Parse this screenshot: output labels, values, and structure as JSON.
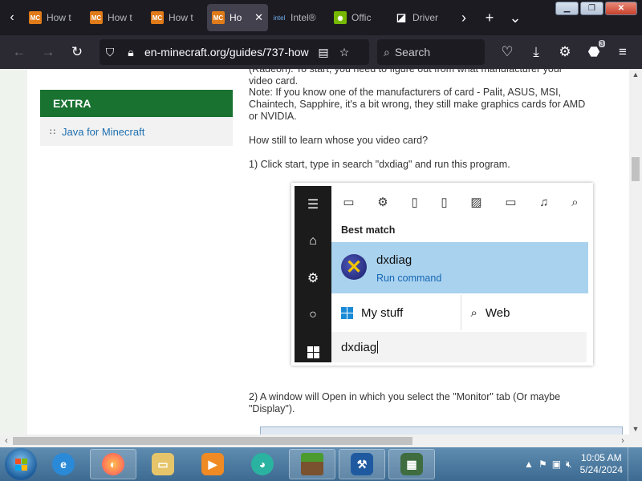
{
  "browser": {
    "tabs": [
      {
        "label": "How t",
        "favicon": "MC",
        "active": false
      },
      {
        "label": "How t",
        "favicon": "MC",
        "active": false
      },
      {
        "label": "How t",
        "favicon": "MC",
        "active": false
      },
      {
        "label": "Ho",
        "favicon": "MC",
        "active": true
      },
      {
        "label": "Intel®",
        "favicon": "intel",
        "active": false
      },
      {
        "label": "Offic",
        "favicon": "nvidia",
        "active": false
      },
      {
        "label": "Driver",
        "favicon": "amd",
        "active": false
      }
    ],
    "tab_close_glyph": "✕",
    "url": "en-minecraft.org/guides/737-how",
    "search_placeholder": "Search",
    "extensions_badge": "3"
  },
  "sidebar": {
    "heading": "EXTRA",
    "links": [
      "Java for Minecraft"
    ]
  },
  "article": {
    "para1_line1": "(Radeon). To start, you need to figure out from what manufacturer your",
    "para1_line2": "video card.",
    "para2_line1": "Note: If you know one of the manufacturers of card - Palit, ASUS, MSI,",
    "para2_line2": "Chaintech, Sapphire, it's a bit wrong, they still make graphics cards for AMD",
    "para2_line3": "or NVIDIA.",
    "question": "How still to learn whose you video card?",
    "step1": "1) Click start, type in search \"dxdiag\" and run this program.",
    "step2_line1": "2) A window will Open in which you select the \"Monitor\" tab (Or maybe",
    "step2_line2": "\"Display\")."
  },
  "search_screenshot": {
    "best_match": "Best match",
    "result_title": "dxdiag",
    "result_subtitle": "Run command",
    "my_stuff": "My stuff",
    "web": "Web",
    "query": "dxdiag"
  },
  "taskbar": {
    "time": "10:05 AM",
    "date": "5/24/2024"
  },
  "colors": {
    "extra_header": "#197230",
    "link": "#1e6fb0",
    "match_highlight": "#a9d2ee"
  }
}
